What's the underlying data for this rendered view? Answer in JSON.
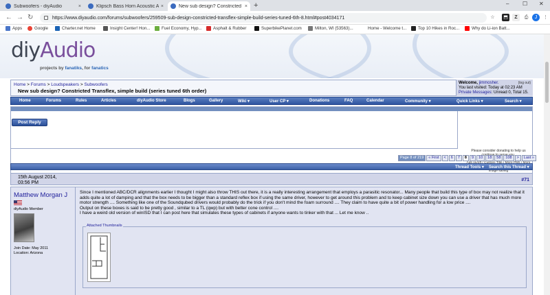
{
  "browser": {
    "tabs": [
      {
        "title": "Subwoofers - diyAudio",
        "active": false
      },
      {
        "title": "Klipsch Bass Horn Acoustic Anal...",
        "active": false
      },
      {
        "title": "New sub design? Constricted Tra...",
        "active": true
      }
    ],
    "new_tab": "+",
    "close": "×",
    "window_controls": [
      "–",
      "☐",
      "✕"
    ],
    "nav": {
      "back": "←",
      "forward": "→",
      "reload": "↻"
    },
    "url": "https://www.diyaudio.com/forums/subwoofers/259509-sub-design-constricted-transflex-simple-build-series-tuned-6th-8.html#post4034171",
    "extensions": [
      "☆",
      "⬒",
      "Z",
      "⎙",
      "J",
      "⋮"
    ],
    "bookmarks": [
      {
        "label": "Apps",
        "color": "#4a76c9"
      },
      {
        "label": "Google",
        "color": "#ea4335"
      },
      {
        "label": "Charter.net Home",
        "color": "#1b63b5"
      },
      {
        "label": "Insight Center! Hon...",
        "color": "#555555"
      },
      {
        "label": "Fuel Economy, Hyp...",
        "color": "#6cae3f"
      },
      {
        "label": "Asphalt & Rubber",
        "color": "#d62b2b"
      },
      {
        "label": "SuperbikePlanet.com",
        "color": "#111111"
      },
      {
        "label": "Milton, WI (53563)...",
        "color": "#777777"
      },
      {
        "label": "Home - Welcome t...",
        "color": "#ffffff"
      },
      {
        "label": "Top 10 Hikes in Roc...",
        "color": "#222222"
      },
      {
        "label": "Why do Li-ion Batt...",
        "color": "#ff0000"
      }
    ]
  },
  "site": {
    "logo_diy": "diy",
    "logo_audio": "Audio",
    "tagline_prefix": "projects by ",
    "tagline_fanatics1": "fanatiks",
    "tagline_mid": ", for ",
    "tagline_fanatics2": "fanatics"
  },
  "breadcrumb": {
    "home": "Home",
    "forums": "Forums",
    "cat": "Loudspeakers",
    "sub": "Subwoofers",
    "sep": ">",
    "title": "New sub design? Constricted Transflex, simple build (series tuned 6th order)"
  },
  "welcome": {
    "label": "Welcome, ",
    "user": "jimmosher.",
    "logout": "(log out)",
    "last_visited": "You last visited: Today at 02:23 AM",
    "pm_label": "Private Messages",
    "pm_text": ": Unread 0, Total 15."
  },
  "menu": [
    "Home",
    "Forums",
    "Rules",
    "Articles",
    "diyAudio Store",
    "Blogs",
    "Gallery",
    "Wiki ▾",
    "User CP ▾",
    "Donations",
    "FAQ",
    "Calendar",
    "Community ▾",
    "Quick Links ▾",
    "Search ▾"
  ],
  "notice": {
    "donate": "Please consider donating to help us continue to serve you.",
    "ad_options": "Ads on/off / Custom Title / More PMs / More album space / Advanced printing & mass image saving"
  },
  "post_reply": "Post Reply",
  "pager": {
    "label": "Page 8 of 219",
    "items": [
      "« First",
      "<",
      "6",
      "7",
      "8",
      "9",
      "10",
      "18",
      "58",
      "108",
      ">",
      "Last »"
    ],
    "current": "8"
  },
  "thread_tools": "Thread Tools ▾",
  "search_thread": "Search this Thread ▾",
  "post": {
    "date": "15th August 2014,",
    "time": "03:56 PM",
    "number": "#71",
    "username": "Matthew Morgan J",
    "user_title": "diyAudio Member",
    "join_date": "Join Date: May 2011",
    "location": "Location: Arizona",
    "text1": "Since I mentioned ABC/DCR alignments earlier I thought I might also throw THIS out there, it is a really interesting arrangement that employs a parasitic resonator... Many people that build this type of box may not realize that it adds quite a lot of damping and that the box needs to be bigger than a standard reflex box if using the same driver, however to get around this problem and to keep cabinet size down you can use a driver that has much more motor strength .... Something like one of the Soundqubed drivers would probably do the trick if you don't mind the foam surround .... They claim to have quite a bit of power handling for a low price ....",
    "text2": "Output on these boxes is said to be pretty good , similar to a TL (qwp) but with better cone control ....",
    "text3": "I have a weird old version of winISD that I can post here that simulates these types of cabinets if anyone wants to tinker with that ... Let me know ..",
    "attached": "Attached Thumbnails"
  }
}
